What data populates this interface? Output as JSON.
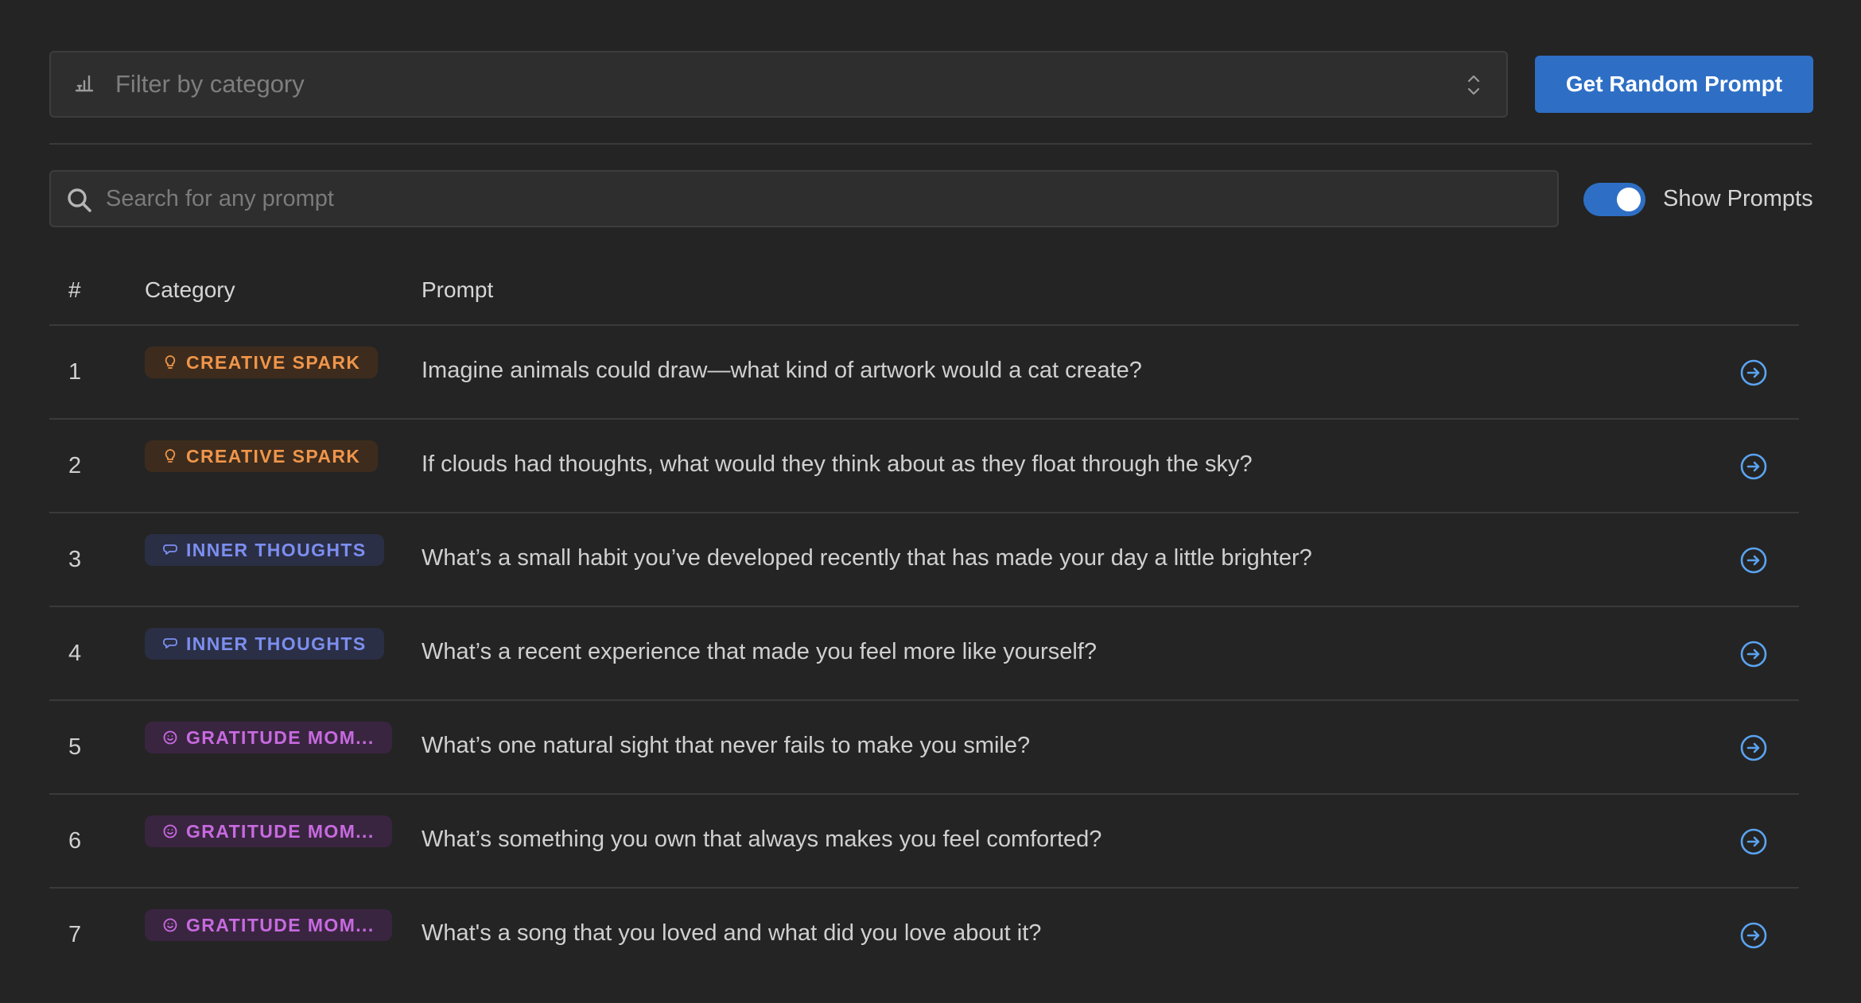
{
  "filter": {
    "placeholder": "Filter by category",
    "icon": "filter-list-icon"
  },
  "random_button": {
    "label": "Get Random Prompt"
  },
  "search": {
    "placeholder": "Search for any prompt",
    "icon": "search-icon"
  },
  "toggle": {
    "label": "Show Prompts",
    "checked": true
  },
  "table": {
    "headers": {
      "num": "#",
      "category": "Category",
      "prompt": "Prompt"
    },
    "rows": [
      {
        "num": "1",
        "category": "CREATIVE SPARK",
        "category_icon": "lightbulb-icon",
        "prompt": "Imagine animals could draw—what kind of artwork would a cat create?"
      },
      {
        "num": "2",
        "category": "CREATIVE SPARK",
        "category_icon": "lightbulb-icon",
        "prompt": "If clouds had thoughts, what would they think about as they float through the sky?"
      },
      {
        "num": "3",
        "category": "INNER THOUGHTS",
        "category_icon": "thought-bubble-icon",
        "prompt": "What’s a small habit you’ve developed recently that has made your day a little brighter?"
      },
      {
        "num": "4",
        "category": "INNER THOUGHTS",
        "category_icon": "thought-bubble-icon",
        "prompt": "What’s a recent experience that made you feel more like yourself?"
      },
      {
        "num": "5",
        "category": "GRATITUDE MOM...",
        "category_icon": "smile-icon",
        "prompt": "What’s one natural sight that never fails to make you smile?"
      },
      {
        "num": "6",
        "category": "GRATITUDE MOM...",
        "category_icon": "smile-icon",
        "prompt": "What’s something you own that always makes you feel comforted?"
      },
      {
        "num": "7",
        "category": "GRATITUDE MOM...",
        "category_icon": "smile-icon",
        "prompt": "What's a song that you loved and what did you love about it?"
      }
    ]
  },
  "colors": {
    "background": "#242424",
    "accent": "#2e6fc5",
    "creative_spark": "#f0954a",
    "inner_thoughts": "#7c8ef0",
    "gratitude": "#c76ae0",
    "row_action": "#5aa3f0"
  }
}
